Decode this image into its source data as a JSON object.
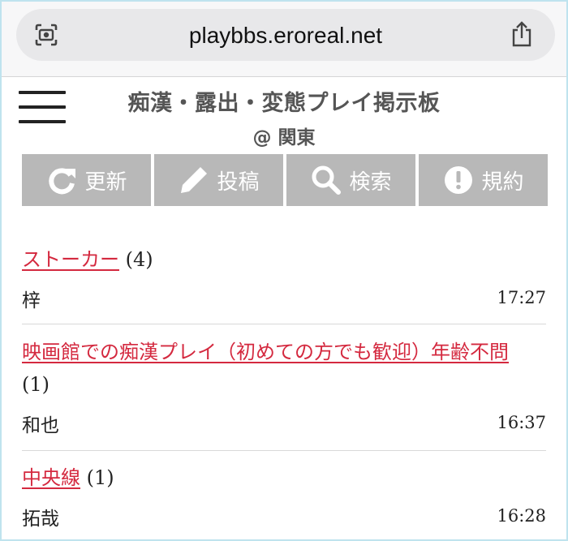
{
  "browser": {
    "url": "playbbs.eroreal.net",
    "left_icon": "visual-search-icon",
    "right_icon": "share-icon"
  },
  "header": {
    "title": "痴漢・露出・変態プレイ掲示板",
    "subtitle": "@ 関東",
    "menu_icon": "hamburger-menu-icon"
  },
  "toolbar": {
    "refresh": {
      "label": "更新",
      "icon": "refresh-icon"
    },
    "post": {
      "label": "投稿",
      "icon": "pencil-icon"
    },
    "search": {
      "label": "検索",
      "icon": "search-icon"
    },
    "rules": {
      "label": "規約",
      "icon": "exclamation-icon"
    }
  },
  "threads": [
    {
      "title": "ストーカー",
      "count": "(4)",
      "author": "梓",
      "time": "17:27"
    },
    {
      "title": "映画館での痴漢プレイ（初めての方でも歓迎）年齢不問",
      "count": "(1)",
      "author": "和也",
      "time": "16:37"
    },
    {
      "title": "中央線",
      "count": "(1)",
      "author": "拓哉",
      "time": "16:28"
    }
  ],
  "colors": {
    "link": "#d4293f",
    "button_bg": "#b8b8b8",
    "title_text": "#555555",
    "frame_border": "#bfe3ee"
  }
}
